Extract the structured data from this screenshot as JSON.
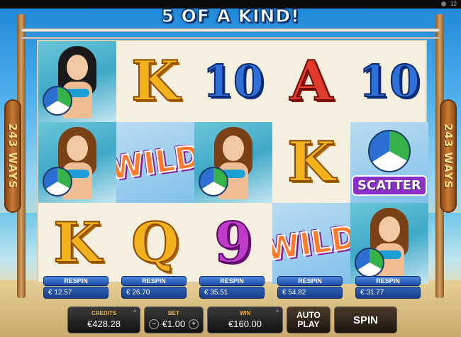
{
  "header": {
    "title": "5 OF A KIND!",
    "status_number": "12"
  },
  "side_signs": {
    "left_text": "243 WAYS",
    "right_text": "243 WAYS"
  },
  "reels": [
    [
      {
        "kind": "girl",
        "name": "girl-sunglasses-symbol"
      },
      {
        "kind": "girl",
        "name": "girl-ball-symbol"
      },
      {
        "kind": "card",
        "label": "K",
        "color": "gold"
      }
    ],
    [
      {
        "kind": "card",
        "label": "K",
        "color": "gold"
      },
      {
        "kind": "wild",
        "label": "WILD"
      },
      {
        "kind": "card",
        "label": "Q",
        "color": "gold"
      }
    ],
    [
      {
        "kind": "card",
        "label": "10",
        "color": "blue"
      },
      {
        "kind": "girl",
        "name": "girl-ball-symbol"
      },
      {
        "kind": "card",
        "label": "9",
        "color": "purple"
      }
    ],
    [
      {
        "kind": "card",
        "label": "A",
        "color": "red"
      },
      {
        "kind": "card",
        "label": "K",
        "color": "gold"
      },
      {
        "kind": "wild",
        "label": "WILD"
      }
    ],
    [
      {
        "kind": "card",
        "label": "10",
        "color": "blue"
      },
      {
        "kind": "scatter",
        "label": "SCATTER"
      },
      {
        "kind": "girl",
        "name": "girl-ball-symbol"
      }
    ]
  ],
  "respin": {
    "label": "RESPIN",
    "costs": [
      "€ 12.57",
      "€ 26.70",
      "€ 35.51",
      "€ 54.82",
      "€ 31.77"
    ]
  },
  "controls": {
    "credits_label": "CREDITS",
    "credits_value": "€428.28",
    "bet_label": "BET",
    "bet_value": "€1.00",
    "bet_minus": "−",
    "bet_plus": "+",
    "win_label": "WIN",
    "win_value": "€160.00",
    "autoplay_label_1": "AUTO",
    "autoplay_label_2": "PLAY",
    "spin_label": "SPIN",
    "expand_icon": "^"
  },
  "colors": {
    "gold": "#f2b21b",
    "blue": "#2f6fd8",
    "red": "#e23a2b",
    "purple": "#c03acb",
    "control_accent": "#e3b04b"
  }
}
